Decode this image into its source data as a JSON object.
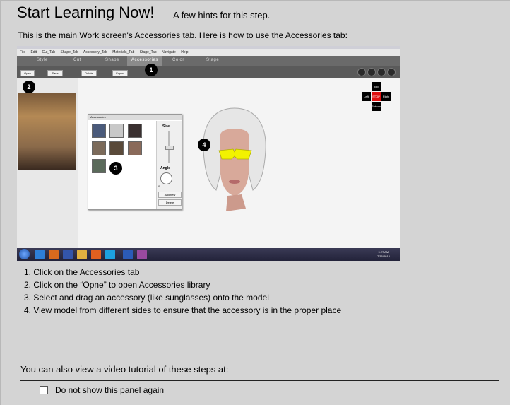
{
  "header": {
    "title": "Start Learning Now!",
    "subtitle": "A few hints for this step."
  },
  "intro": "This is the main Work screen's Accessories tab. Here is how to use the Accessories tab:",
  "app": {
    "menu": [
      "File",
      "Edit",
      "Cut_Tab",
      "Shape_Tab",
      "Accessory_Tab",
      "Materials_Tab",
      "Stage_Tab",
      "Navigate",
      "Help"
    ],
    "tabs": [
      "Style",
      "Cut",
      "Shape",
      "Accessories",
      "Color",
      "Stage"
    ],
    "active_tab": "Accessories",
    "toolbar_buttons": [
      "Open",
      "Save",
      "Delete",
      "Export"
    ],
    "nav": {
      "top": "Top",
      "left": "Left",
      "stop": "STOP",
      "right": "Right",
      "bottom": "Bottom"
    },
    "accessories_panel": {
      "title": "Accessories",
      "size_label": "Size",
      "angle_label": "Angle",
      "angle_value": "0",
      "add_new": "Add new",
      "delete": "Delete"
    },
    "clock": {
      "time": "9:27 AM",
      "date": "7/16/2014"
    },
    "markers": [
      "1",
      "2",
      "3",
      "4"
    ],
    "colors": {
      "tabbar": "#6a6a6a",
      "active_tab": "#8b8b8b",
      "stop": "#e01010",
      "glasses": "#f2f200"
    }
  },
  "steps": [
    "1. Click on the Accessories tab",
    "2. Click on the “Opne” to open Accessories library",
    "3. Select and drag an accessory (like sunglasses) onto the model",
    "4. View model from different sides to ensure that the accessory is in the proper place"
  ],
  "video_text": "You can also view a video tutorial of these steps at:",
  "checkbox": {
    "label": "Do not show this panel again",
    "checked": false
  }
}
